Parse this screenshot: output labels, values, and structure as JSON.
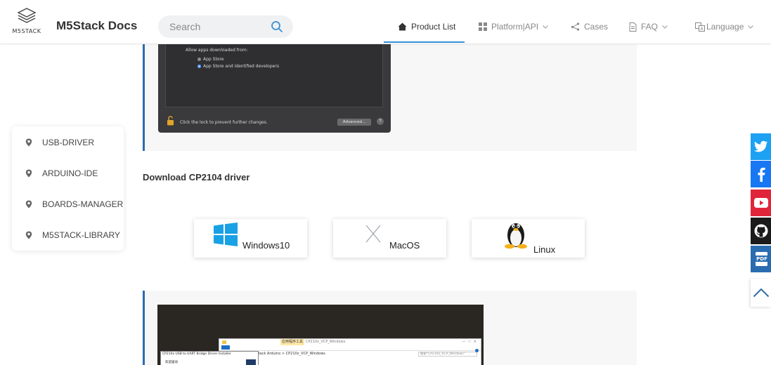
{
  "header": {
    "logo_text": "M5STACK",
    "site_title": "M5Stack Docs",
    "search_placeholder": "Search",
    "nav": [
      {
        "label": "Product List"
      },
      {
        "label": "Platform|API"
      },
      {
        "label": "Cases"
      },
      {
        "label": "FAQ"
      },
      {
        "label": "Language"
      }
    ]
  },
  "sidebar": {
    "items": [
      {
        "label": "USB-DRIVER"
      },
      {
        "label": "ARDUINO-IDE"
      },
      {
        "label": "BOARDS-MANAGER"
      },
      {
        "label": "M5STACK-LIBRARY"
      }
    ]
  },
  "mac_dialog": {
    "allow_label": "Allow apps downloaded from:",
    "option_1": "App Store",
    "option_2": "App Store and identified developers",
    "lock_text": "Click the lock to prevent further changes.",
    "advanced_button": "Advanced...",
    "help": "?"
  },
  "download": {
    "title": "Download CP2104 driver",
    "options": [
      {
        "label": "Windows10",
        "icon": "windows-icon"
      },
      {
        "label": "MacOS",
        "icon": "macos-icon"
      },
      {
        "label": "Linux",
        "icon": "linux-tux-icon"
      }
    ]
  },
  "installer_screenshot": {
    "window_title": "CP210x USB to UART Bridge Driver Installer",
    "path_text": "M5Stack Arduino  >  CP210x_VCP_Windows",
    "tab_text": "CP210x_VCP_Windows",
    "search_text": "搜索\"CP210x_VCP_Windows\"",
    "tool_tab": "应用程序工具",
    "install_label": "欢迎驱动"
  },
  "social": [
    {
      "name": "twitter",
      "color": "#1da1f2"
    },
    {
      "name": "facebook",
      "color": "#1877f2"
    },
    {
      "name": "youtube",
      "color": "#e0253a"
    },
    {
      "name": "github",
      "color": "#1b1b1b"
    },
    {
      "name": "pdf",
      "color": "#2b6cb0"
    }
  ],
  "colors": {
    "accent": "#3a8fd6",
    "block_border": "#2b6cb0",
    "block_bg": "#f7f7f7"
  }
}
